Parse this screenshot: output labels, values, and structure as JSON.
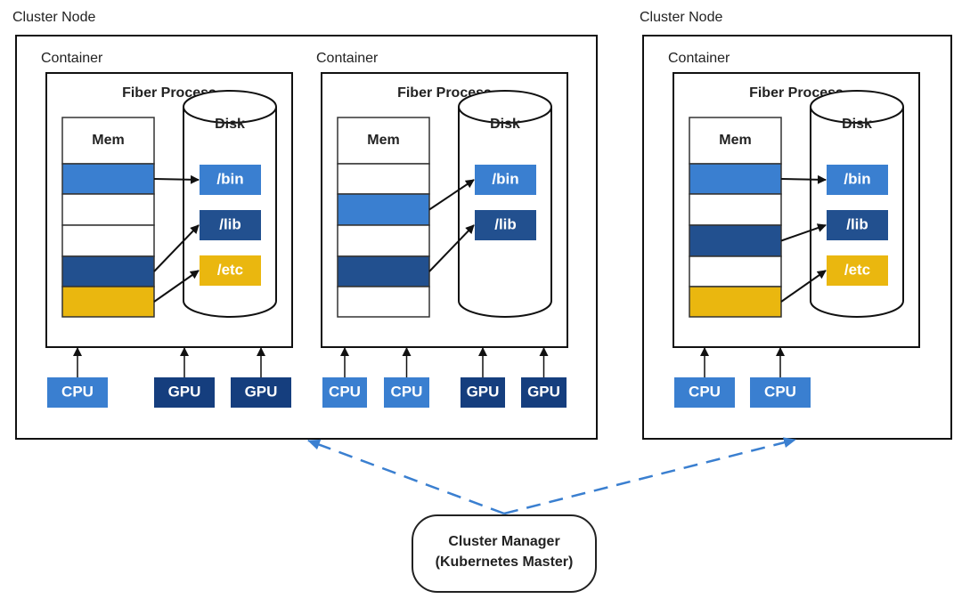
{
  "colors": {
    "light_blue": "#3a7fd0",
    "dark_blue": "#22508f",
    "gpu_blue": "#153e7e",
    "yellow": "#eab70f",
    "dashed_arrow": "#3a7fd0",
    "outline": "#111111"
  },
  "nodes": [
    {
      "label": "Cluster Node",
      "containers": [
        {
          "label": "Container",
          "process_title": "Fiber Process",
          "mem_label": "Mem",
          "mem_cells": [
            "light_blue",
            "white",
            "white",
            "dark_blue",
            "yellow"
          ],
          "disk_label": "Disk",
          "disk_dirs": [
            {
              "label": "/bin",
              "color": "light_blue"
            },
            {
              "label": "/lib",
              "color": "dark_blue"
            },
            {
              "label": "/etc",
              "color": "yellow"
            }
          ],
          "mappings": [
            [
              0,
              0
            ],
            [
              3,
              1
            ],
            [
              4,
              2
            ]
          ],
          "resources": [
            {
              "label": "CPU",
              "color": "light_blue"
            },
            {
              "label": "GPU",
              "color": "gpu_blue"
            },
            {
              "label": "GPU",
              "color": "gpu_blue"
            }
          ]
        },
        {
          "label": "Container",
          "process_title": "Fiber Process",
          "mem_label": "Mem",
          "mem_cells": [
            "white",
            "light_blue",
            "white",
            "dark_blue",
            "white"
          ],
          "disk_label": "Disk",
          "disk_dirs": [
            {
              "label": "/bin",
              "color": "light_blue"
            },
            {
              "label": "/lib",
              "color": "dark_blue"
            }
          ],
          "mappings": [
            [
              1,
              0
            ],
            [
              3,
              1
            ]
          ],
          "resources": [
            {
              "label": "CPU",
              "color": "light_blue"
            },
            {
              "label": "CPU",
              "color": "light_blue"
            },
            {
              "label": "GPU",
              "color": "gpu_blue"
            },
            {
              "label": "GPU",
              "color": "gpu_blue"
            }
          ]
        }
      ]
    },
    {
      "label": "Cluster Node",
      "containers": [
        {
          "label": "Container",
          "process_title": "Fiber Process",
          "mem_label": "Mem",
          "mem_cells": [
            "light_blue",
            "white",
            "dark_blue",
            "white",
            "yellow"
          ],
          "disk_label": "Disk",
          "disk_dirs": [
            {
              "label": "/bin",
              "color": "light_blue"
            },
            {
              "label": "/lib",
              "color": "dark_blue"
            },
            {
              "label": "/etc",
              "color": "yellow"
            }
          ],
          "mappings": [
            [
              0,
              0
            ],
            [
              2,
              1
            ],
            [
              4,
              2
            ]
          ],
          "resources": [
            {
              "label": "CPU",
              "color": "light_blue"
            },
            {
              "label": "CPU",
              "color": "light_blue"
            }
          ]
        }
      ]
    }
  ],
  "manager": {
    "line1": "Cluster Manager",
    "line2": "(Kubernetes Master)"
  }
}
